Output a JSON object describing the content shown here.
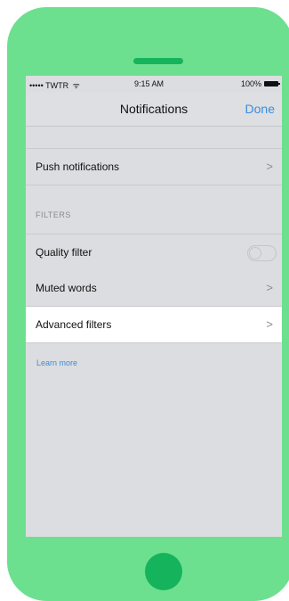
{
  "status_bar": {
    "carrier": "••••• TWTR",
    "wifi_icon": "wifi-icon",
    "time": "9:15 AM",
    "battery": "100%"
  },
  "nav": {
    "title": "Notifications",
    "done_label": "Done"
  },
  "rows": {
    "push_notifications": "Push notifications",
    "filters_header": "FILTERS",
    "quality_filter": "Quality filter",
    "quality_filter_enabled": false,
    "muted_words": "Muted words",
    "advanced_filters": "Advanced filters"
  },
  "chevron": ">",
  "learn_more": "Learn more",
  "colors": {
    "phone_body": "#6de08f",
    "phone_accent": "#15b45c",
    "link": "#3b8ddc",
    "screen_bg": "#dcdde0",
    "selected_row": "#ffffff"
  }
}
